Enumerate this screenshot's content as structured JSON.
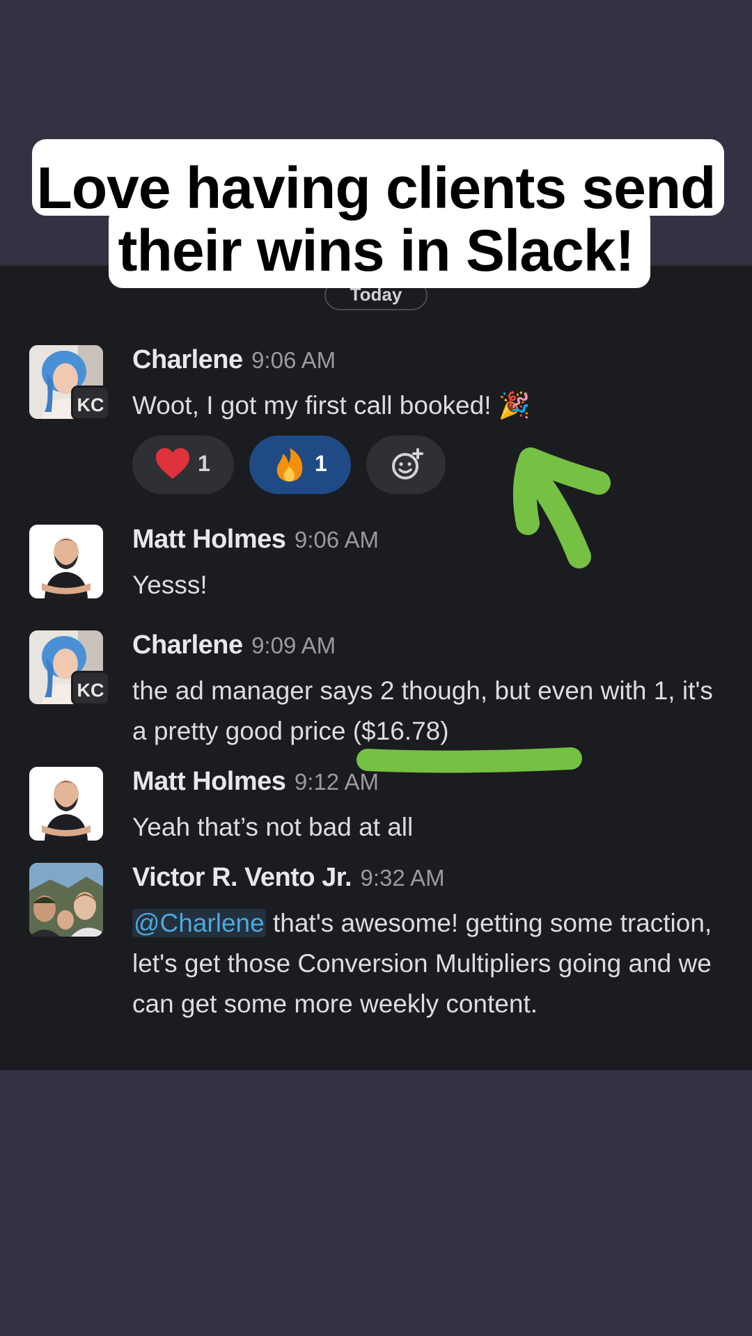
{
  "caption": {
    "line1": "Love having clients send",
    "line2": "their wins in Slack!"
  },
  "divider": {
    "label": "Today"
  },
  "messages": [
    {
      "author": "Charlene",
      "time": "9:06 AM",
      "badge": "KC",
      "text": "Woot, I got my first call booked! 🎉",
      "reactions": [
        {
          "emoji": "heart",
          "count": "1",
          "active": false
        },
        {
          "emoji": "fire",
          "count": "1",
          "active": true
        }
      ]
    },
    {
      "author": "Matt Holmes",
      "time": "9:06 AM",
      "text": "Yesss!"
    },
    {
      "author": "Charlene",
      "time": "9:09 AM",
      "badge": "KC",
      "text": "the ad manager says 2 though, but even with 1, it's a pretty good price ($16.78)"
    },
    {
      "author": "Matt Holmes",
      "time": "9:12 AM",
      "text": "Yeah that’s not bad at all"
    },
    {
      "author": "Victor R. Vento Jr.",
      "time": "9:32 AM",
      "mention": "@Charlene",
      "text": " that's awesome! getting some traction, let's get those Conversion Multipliers going and we can get some more weekly content."
    }
  ],
  "colors": {
    "background": "#333142",
    "chat_panel": "#1b1c1f",
    "mention": "#4ea7de",
    "reaction_active": "#1f4a86",
    "annotation_green": "#76c043"
  },
  "icons": {
    "add_reaction": "add-emoji-icon",
    "party": "party-popper-icon"
  }
}
